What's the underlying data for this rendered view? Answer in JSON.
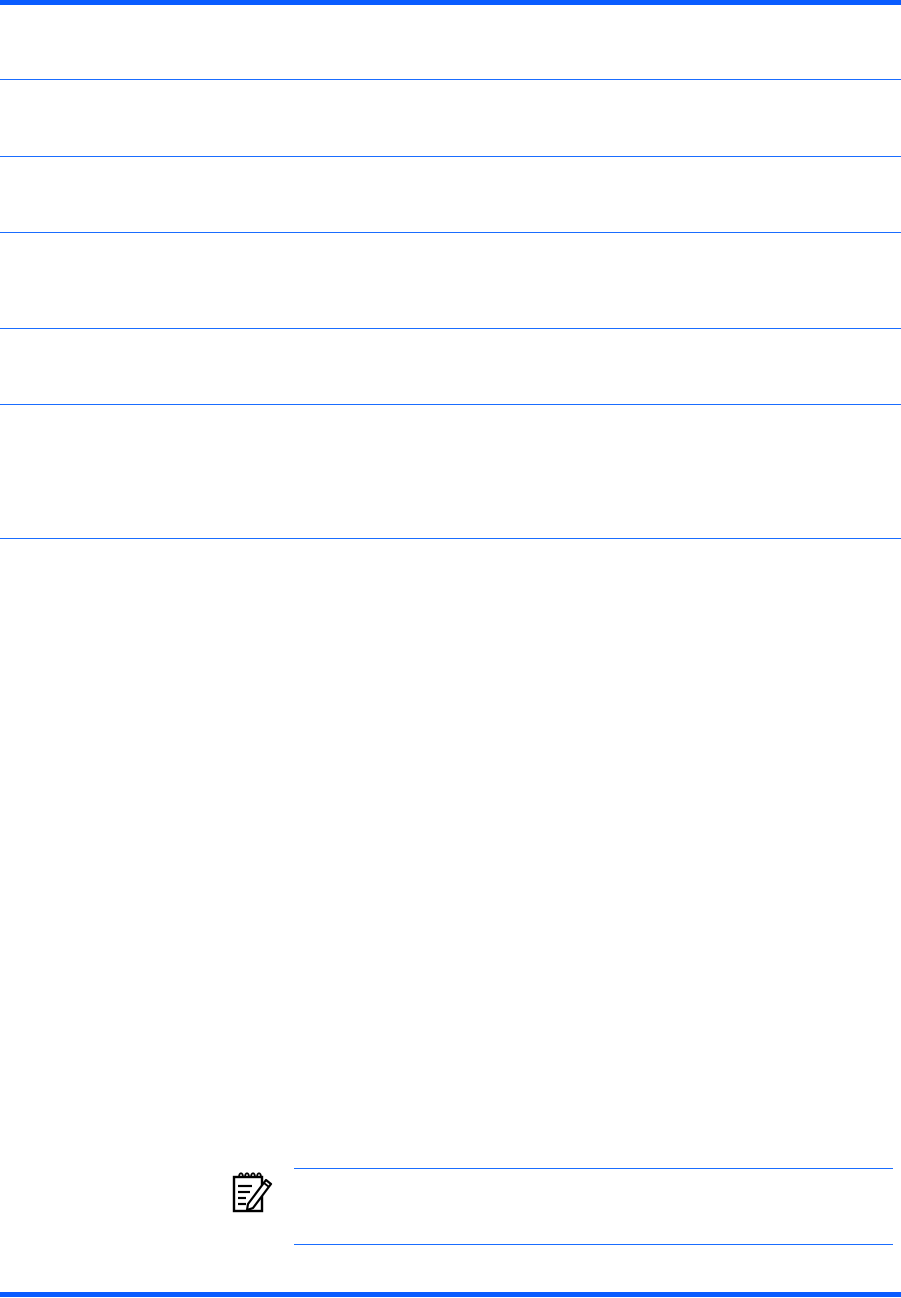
{
  "table": {
    "rows": [
      {
        "label": "",
        "description": ""
      },
      {
        "label": "",
        "description": ""
      },
      {
        "label": "",
        "description": ""
      },
      {
        "label": "",
        "description": ""
      },
      {
        "label": "",
        "description": ""
      },
      {
        "label": "",
        "description": ""
      }
    ]
  },
  "note": {
    "icon": "note-pencil-icon",
    "text": ""
  },
  "colors": {
    "accent": "#0a5cff",
    "rule": "#1a6dff"
  }
}
